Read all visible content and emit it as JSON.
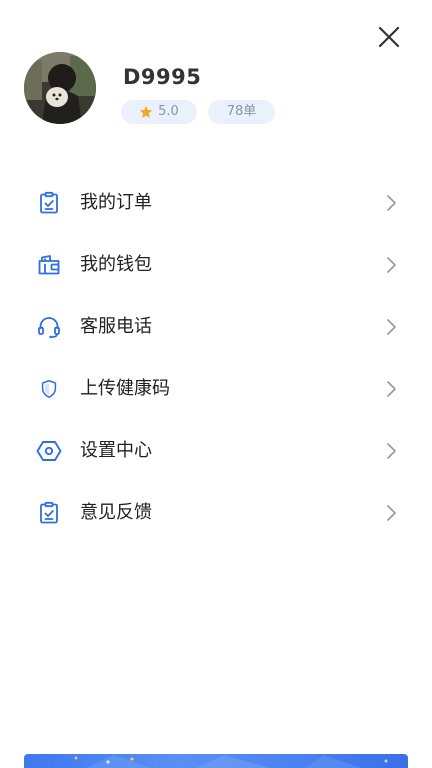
{
  "user": {
    "name": "D9995",
    "rating": "5.0",
    "orders": "78单"
  },
  "menu": {
    "items": [
      {
        "label": "我的订单",
        "icon": "clipboard-check-icon"
      },
      {
        "label": "我的钱包",
        "icon": "wallet-icon"
      },
      {
        "label": "客服电话",
        "icon": "headset-icon"
      },
      {
        "label": "上传健康码",
        "icon": "shield-icon"
      },
      {
        "label": "设置中心",
        "icon": "settings-hexagon-icon"
      },
      {
        "label": "意见反馈",
        "icon": "clipboard-check-icon"
      }
    ]
  },
  "colors": {
    "accent": "#2f6fe0",
    "star": "#f5a623",
    "badge_bg": "#eaf1fc",
    "chevron": "#9a9a9a"
  }
}
